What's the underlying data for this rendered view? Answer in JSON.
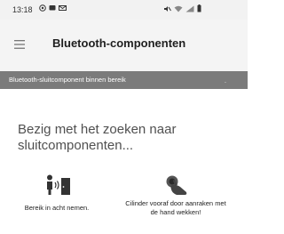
{
  "status_bar": {
    "time": "13:18",
    "left_icons": [
      "camera-icon",
      "message-icon",
      "mail-icon"
    ],
    "right_icons": [
      "mute-icon",
      "wifi-icon",
      "signal-icon",
      "battery-icon"
    ]
  },
  "app_bar": {
    "menu_icon": "hamburger-menu-icon",
    "title": "Bluetooth-componenten"
  },
  "banner": {
    "text": "Bluetooth-sluitcomponent binnen bereik",
    "dot": "."
  },
  "main": {
    "heading": "Bezig met het zoeken naar sluitcomponenten..."
  },
  "hints": [
    {
      "icon": "person-door-range-icon",
      "label": "Bereik in acht nemen."
    },
    {
      "icon": "hand-touch-cylinder-icon",
      "label": "Cilinder vooraf door aanraken met de hand wekken!"
    }
  ],
  "colors": {
    "app_bar_bg": "#f4f4f4",
    "banner_bg": "#7b7b7b",
    "heading_text": "#505050"
  }
}
